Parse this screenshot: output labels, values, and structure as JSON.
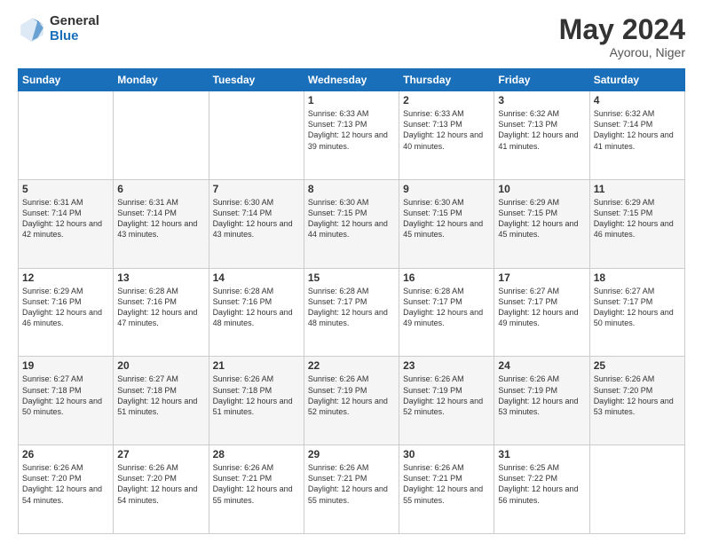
{
  "logo": {
    "general": "General",
    "blue": "Blue"
  },
  "header": {
    "month": "May 2024",
    "location": "Ayorou, Niger"
  },
  "days_of_week": [
    "Sunday",
    "Monday",
    "Tuesday",
    "Wednesday",
    "Thursday",
    "Friday",
    "Saturday"
  ],
  "weeks": [
    [
      {
        "day": "",
        "sunrise": "",
        "sunset": "",
        "daylight": ""
      },
      {
        "day": "",
        "sunrise": "",
        "sunset": "",
        "daylight": ""
      },
      {
        "day": "",
        "sunrise": "",
        "sunset": "",
        "daylight": ""
      },
      {
        "day": "1",
        "sunrise": "Sunrise: 6:33 AM",
        "sunset": "Sunset: 7:13 PM",
        "daylight": "Daylight: 12 hours and 39 minutes."
      },
      {
        "day": "2",
        "sunrise": "Sunrise: 6:33 AM",
        "sunset": "Sunset: 7:13 PM",
        "daylight": "Daylight: 12 hours and 40 minutes."
      },
      {
        "day": "3",
        "sunrise": "Sunrise: 6:32 AM",
        "sunset": "Sunset: 7:13 PM",
        "daylight": "Daylight: 12 hours and 41 minutes."
      },
      {
        "day": "4",
        "sunrise": "Sunrise: 6:32 AM",
        "sunset": "Sunset: 7:14 PM",
        "daylight": "Daylight: 12 hours and 41 minutes."
      }
    ],
    [
      {
        "day": "5",
        "sunrise": "Sunrise: 6:31 AM",
        "sunset": "Sunset: 7:14 PM",
        "daylight": "Daylight: 12 hours and 42 minutes."
      },
      {
        "day": "6",
        "sunrise": "Sunrise: 6:31 AM",
        "sunset": "Sunset: 7:14 PM",
        "daylight": "Daylight: 12 hours and 43 minutes."
      },
      {
        "day": "7",
        "sunrise": "Sunrise: 6:30 AM",
        "sunset": "Sunset: 7:14 PM",
        "daylight": "Daylight: 12 hours and 43 minutes."
      },
      {
        "day": "8",
        "sunrise": "Sunrise: 6:30 AM",
        "sunset": "Sunset: 7:15 PM",
        "daylight": "Daylight: 12 hours and 44 minutes."
      },
      {
        "day": "9",
        "sunrise": "Sunrise: 6:30 AM",
        "sunset": "Sunset: 7:15 PM",
        "daylight": "Daylight: 12 hours and 45 minutes."
      },
      {
        "day": "10",
        "sunrise": "Sunrise: 6:29 AM",
        "sunset": "Sunset: 7:15 PM",
        "daylight": "Daylight: 12 hours and 45 minutes."
      },
      {
        "day": "11",
        "sunrise": "Sunrise: 6:29 AM",
        "sunset": "Sunset: 7:15 PM",
        "daylight": "Daylight: 12 hours and 46 minutes."
      }
    ],
    [
      {
        "day": "12",
        "sunrise": "Sunrise: 6:29 AM",
        "sunset": "Sunset: 7:16 PM",
        "daylight": "Daylight: 12 hours and 46 minutes."
      },
      {
        "day": "13",
        "sunrise": "Sunrise: 6:28 AM",
        "sunset": "Sunset: 7:16 PM",
        "daylight": "Daylight: 12 hours and 47 minutes."
      },
      {
        "day": "14",
        "sunrise": "Sunrise: 6:28 AM",
        "sunset": "Sunset: 7:16 PM",
        "daylight": "Daylight: 12 hours and 48 minutes."
      },
      {
        "day": "15",
        "sunrise": "Sunrise: 6:28 AM",
        "sunset": "Sunset: 7:17 PM",
        "daylight": "Daylight: 12 hours and 48 minutes."
      },
      {
        "day": "16",
        "sunrise": "Sunrise: 6:28 AM",
        "sunset": "Sunset: 7:17 PM",
        "daylight": "Daylight: 12 hours and 49 minutes."
      },
      {
        "day": "17",
        "sunrise": "Sunrise: 6:27 AM",
        "sunset": "Sunset: 7:17 PM",
        "daylight": "Daylight: 12 hours and 49 minutes."
      },
      {
        "day": "18",
        "sunrise": "Sunrise: 6:27 AM",
        "sunset": "Sunset: 7:17 PM",
        "daylight": "Daylight: 12 hours and 50 minutes."
      }
    ],
    [
      {
        "day": "19",
        "sunrise": "Sunrise: 6:27 AM",
        "sunset": "Sunset: 7:18 PM",
        "daylight": "Daylight: 12 hours and 50 minutes."
      },
      {
        "day": "20",
        "sunrise": "Sunrise: 6:27 AM",
        "sunset": "Sunset: 7:18 PM",
        "daylight": "Daylight: 12 hours and 51 minutes."
      },
      {
        "day": "21",
        "sunrise": "Sunrise: 6:26 AM",
        "sunset": "Sunset: 7:18 PM",
        "daylight": "Daylight: 12 hours and 51 minutes."
      },
      {
        "day": "22",
        "sunrise": "Sunrise: 6:26 AM",
        "sunset": "Sunset: 7:19 PM",
        "daylight": "Daylight: 12 hours and 52 minutes."
      },
      {
        "day": "23",
        "sunrise": "Sunrise: 6:26 AM",
        "sunset": "Sunset: 7:19 PM",
        "daylight": "Daylight: 12 hours and 52 minutes."
      },
      {
        "day": "24",
        "sunrise": "Sunrise: 6:26 AM",
        "sunset": "Sunset: 7:19 PM",
        "daylight": "Daylight: 12 hours and 53 minutes."
      },
      {
        "day": "25",
        "sunrise": "Sunrise: 6:26 AM",
        "sunset": "Sunset: 7:20 PM",
        "daylight": "Daylight: 12 hours and 53 minutes."
      }
    ],
    [
      {
        "day": "26",
        "sunrise": "Sunrise: 6:26 AM",
        "sunset": "Sunset: 7:20 PM",
        "daylight": "Daylight: 12 hours and 54 minutes."
      },
      {
        "day": "27",
        "sunrise": "Sunrise: 6:26 AM",
        "sunset": "Sunset: 7:20 PM",
        "daylight": "Daylight: 12 hours and 54 minutes."
      },
      {
        "day": "28",
        "sunrise": "Sunrise: 6:26 AM",
        "sunset": "Sunset: 7:21 PM",
        "daylight": "Daylight: 12 hours and 55 minutes."
      },
      {
        "day": "29",
        "sunrise": "Sunrise: 6:26 AM",
        "sunset": "Sunset: 7:21 PM",
        "daylight": "Daylight: 12 hours and 55 minutes."
      },
      {
        "day": "30",
        "sunrise": "Sunrise: 6:26 AM",
        "sunset": "Sunset: 7:21 PM",
        "daylight": "Daylight: 12 hours and 55 minutes."
      },
      {
        "day": "31",
        "sunrise": "Sunrise: 6:25 AM",
        "sunset": "Sunset: 7:22 PM",
        "daylight": "Daylight: 12 hours and 56 minutes."
      },
      {
        "day": "",
        "sunrise": "",
        "sunset": "",
        "daylight": ""
      }
    ]
  ]
}
